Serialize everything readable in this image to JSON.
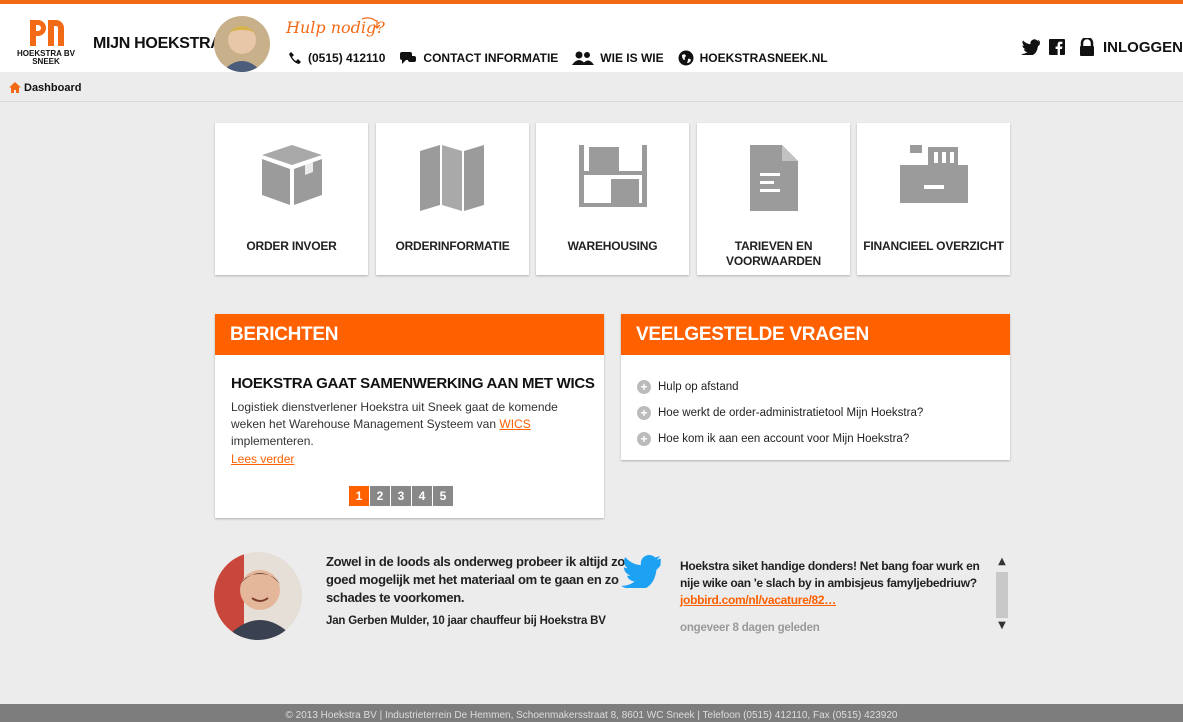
{
  "header": {
    "brand_line1": "HOEKSTRA BV",
    "brand_line2": "SNEEK",
    "app_title": "MIJN HOEKSTRA",
    "help_text": "Hulp nodig?",
    "phone": "(0515) 412110",
    "contact": "CONTACT INFORMATIE",
    "who": "WIE IS WIE",
    "website": "HOEKSTRASNEEK.NL",
    "login": "INLOGGEN"
  },
  "breadcrumb": {
    "label": "Dashboard"
  },
  "tiles": [
    {
      "label": "ORDER INVOER",
      "icon": "box-icon"
    },
    {
      "label": "ORDERINFORMATIE",
      "icon": "map-icon"
    },
    {
      "label": "WAREHOUSING",
      "icon": "shelf-icon"
    },
    {
      "label": "TARIEVEN EN VOORWAARDEN",
      "icon": "document-icon"
    },
    {
      "label": "FINANCIEEL OVERZICHT",
      "icon": "cash-register-icon"
    }
  ],
  "news": {
    "heading": "BERICHTEN",
    "title": "HOEKSTRA GAAT SAMENWERKING AAN MET WICS",
    "body": "Logistiek dienstverlener Hoekstra uit Sneek gaat de komende weken het Warehouse Management Systeem van",
    "link": "WICS",
    "body_end": "implementeren.",
    "read_more": "Lees verder",
    "pages": [
      "1",
      "2",
      "3",
      "4",
      "5"
    ],
    "active_page": "1"
  },
  "faq": {
    "heading": "VEELGESTELDE VRAGEN",
    "items": [
      "Hulp op afstand",
      "Hoe werkt de order-administratietool Mijn Hoekstra?",
      "Hoe kom ik aan een account voor Mijn Hoekstra?"
    ]
  },
  "testimonial": {
    "quote": "Zowel in de loods als onderweg probeer ik altijd zo goed mogelijk met het materiaal om te gaan en zo schades te voorkomen.",
    "author": "Jan Gerben Mulder, 10 jaar chauffeur bij Hoekstra BV"
  },
  "tweet": {
    "text": "Hoekstra siket handige donders! Net bang foar wurk en nije wike oan 'e slach by in ambisjeus famyljebedriuw?",
    "link": "jobbird.com/nl/vacature/82…",
    "time": "ongeveer 8 dagen geleden"
  },
  "footer": {
    "text": "© 2013 Hoekstra BV | Industrieterrein De Hemmen, Schoenmakersstraat 8, 8601 WC Sneek | Telefoon (0515) 412110, Fax (0515) 423920"
  },
  "colors": {
    "accent": "#ff6000",
    "header_border": "#f26a16",
    "icon_gray": "#9b9b9b"
  }
}
